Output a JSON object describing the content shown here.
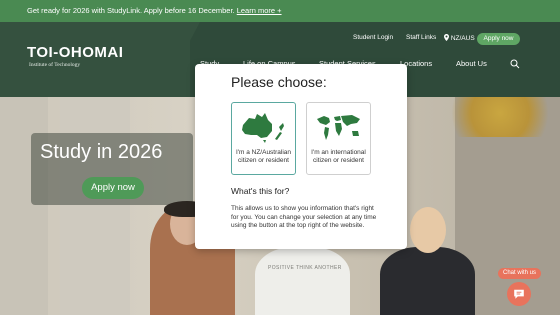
{
  "announcement": {
    "text": "Get ready for 2026 with StudyLink. Apply before 16 December.",
    "link_label": "Learn more +"
  },
  "header": {
    "logo_main": "TOI-OHOMAI",
    "logo_sub": "Institute of Technology",
    "utility": {
      "student_login": "Student Login",
      "staff_links": "Staff Links",
      "region": "NZ/AUS",
      "apply": "Apply now"
    },
    "nav": [
      "Study",
      "Life on Campus",
      "Student Services",
      "Locations",
      "About Us"
    ]
  },
  "hero": {
    "title": "Study in 2026",
    "apply_label": "Apply now",
    "shirt_text": "POSITIVE THINK ANOTHER"
  },
  "modal": {
    "title": "Please choose:",
    "choices": [
      {
        "label": "I'm a NZ/Australian citizen or resident",
        "icon": "nz-australia-map-icon"
      },
      {
        "label": "I'm an international citizen or resident",
        "icon": "world-map-icon"
      }
    ],
    "whats_this": "What's this for?",
    "explanation": "This allows us to show you information that's right for you. You can change your selection at any time using the button at the top right of the website."
  },
  "chat": {
    "label": "Chat with us"
  },
  "colors": {
    "accent_green": "#4a8a52",
    "header_dark": "#2f4a3a",
    "chat_orange": "#e8735c",
    "map_green": "#2e7a3f"
  }
}
